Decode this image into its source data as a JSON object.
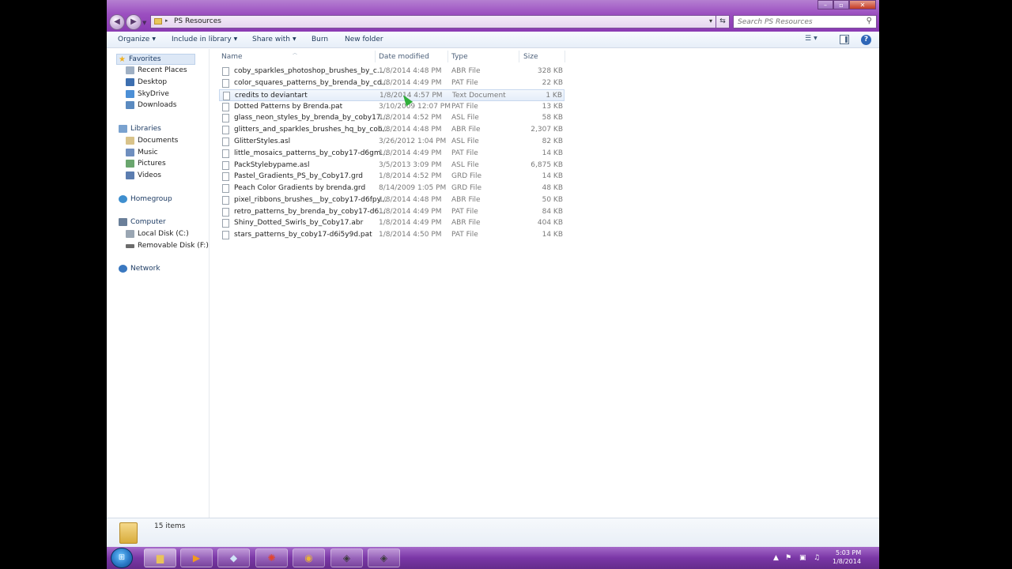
{
  "window": {
    "address_path": "PS Resources",
    "search_placeholder": "Search PS Resources"
  },
  "toolbar": {
    "organize": "Organize",
    "include_in_library": "Include in library",
    "share_with": "Share with",
    "burn": "Burn",
    "new_folder": "New folder"
  },
  "nav": {
    "favorites": "Favorites",
    "recent_places": "Recent Places",
    "desktop": "Desktop",
    "skydrive": "SkyDrive",
    "downloads": "Downloads",
    "libraries": "Libraries",
    "documents": "Documents",
    "music": "Music",
    "pictures": "Pictures",
    "videos": "Videos",
    "homegroup": "Homegroup",
    "computer": "Computer",
    "local_disk": "Local Disk (C:)",
    "removable_disk": "Removable Disk (F:)",
    "network": "Network"
  },
  "columns": {
    "name": "Name",
    "date": "Date modified",
    "type": "Type",
    "size": "Size"
  },
  "files": [
    {
      "name": "coby_sparkles_photoshop_brushes_by_c...",
      "date": "1/8/2014 4:48 PM",
      "type": "ABR File",
      "size": "328 KB"
    },
    {
      "name": "color_squares_patterns_by_brenda_by_co...",
      "date": "1/8/2014 4:49 PM",
      "type": "PAT File",
      "size": "22 KB"
    },
    {
      "name": "credits to deviantart",
      "date": "1/8/2014 4:57 PM",
      "type": "Text Document",
      "size": "1 KB"
    },
    {
      "name": "Dotted Patterns by Brenda.pat",
      "date": "3/10/2009 12:07 PM",
      "type": "PAT File",
      "size": "13 KB"
    },
    {
      "name": "glass_neon_styles_by_brenda_by_coby17...",
      "date": "1/8/2014 4:52 PM",
      "type": "ASL File",
      "size": "58 KB"
    },
    {
      "name": "glitters_and_sparkles_brushes_hq_by_cob...",
      "date": "1/8/2014 4:48 PM",
      "type": "ABR File",
      "size": "2,307 KB"
    },
    {
      "name": "GlitterStyles.asl",
      "date": "3/26/2012 1:04 PM",
      "type": "ASL File",
      "size": "82 KB"
    },
    {
      "name": "little_mosaics_patterns_by_coby17-d6gm...",
      "date": "1/8/2014 4:49 PM",
      "type": "PAT File",
      "size": "14 KB"
    },
    {
      "name": "PackStylebypame.asl",
      "date": "3/5/2013 3:09 PM",
      "type": "ASL File",
      "size": "6,875 KB"
    },
    {
      "name": "Pastel_Gradients_PS_by_Coby17.grd",
      "date": "1/8/2014 4:52 PM",
      "type": "GRD File",
      "size": "14 KB"
    },
    {
      "name": "Peach Color Gradients by brenda.grd",
      "date": "8/14/2009 1:05 PM",
      "type": "GRD File",
      "size": "48 KB"
    },
    {
      "name": "pixel_ribbons_brushes__by_coby17-d6fpy...",
      "date": "1/8/2014 4:48 PM",
      "type": "ABR File",
      "size": "50 KB"
    },
    {
      "name": "retro_patterns_by_brenda_by_coby17-d6...",
      "date": "1/8/2014 4:49 PM",
      "type": "PAT File",
      "size": "84 KB"
    },
    {
      "name": "Shiny_Dotted_Swirls_by_Coby17.abr",
      "date": "1/8/2014 4:49 PM",
      "type": "ABR File",
      "size": "404 KB"
    },
    {
      "name": "stars_patterns_by_coby17-d6i5y9d.pat",
      "date": "1/8/2014 4:50 PM",
      "type": "PAT File",
      "size": "14 KB"
    }
  ],
  "details": {
    "item_count": "15 items"
  },
  "taskbar": {
    "time": "5:03 PM",
    "date": "1/8/2014"
  }
}
